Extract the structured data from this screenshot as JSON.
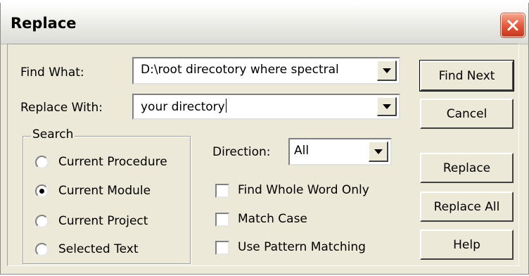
{
  "dialog": {
    "title": "Replace"
  },
  "find": {
    "label": "Find What:",
    "value": "D:\\root direcotory where spectral"
  },
  "replace": {
    "label": "Replace With:",
    "value": "your directory"
  },
  "search": {
    "label": "Search",
    "options": [
      {
        "label": "Current Procedure",
        "selected": false
      },
      {
        "label": "Current Module",
        "selected": true
      },
      {
        "label": "Current Project",
        "selected": false
      },
      {
        "label": "Selected Text",
        "selected": false
      }
    ]
  },
  "direction": {
    "label": "Direction:",
    "value": "All"
  },
  "options": {
    "whole_word": {
      "label": "Find Whole Word Only",
      "checked": false
    },
    "match_case": {
      "label": "Match Case",
      "checked": false
    },
    "pattern": {
      "label": "Use Pattern Matching",
      "checked": false
    }
  },
  "buttons": {
    "find_next": "Find Next",
    "cancel": "Cancel",
    "replace": "Replace",
    "replace_all": "Replace All",
    "help": "Help"
  }
}
